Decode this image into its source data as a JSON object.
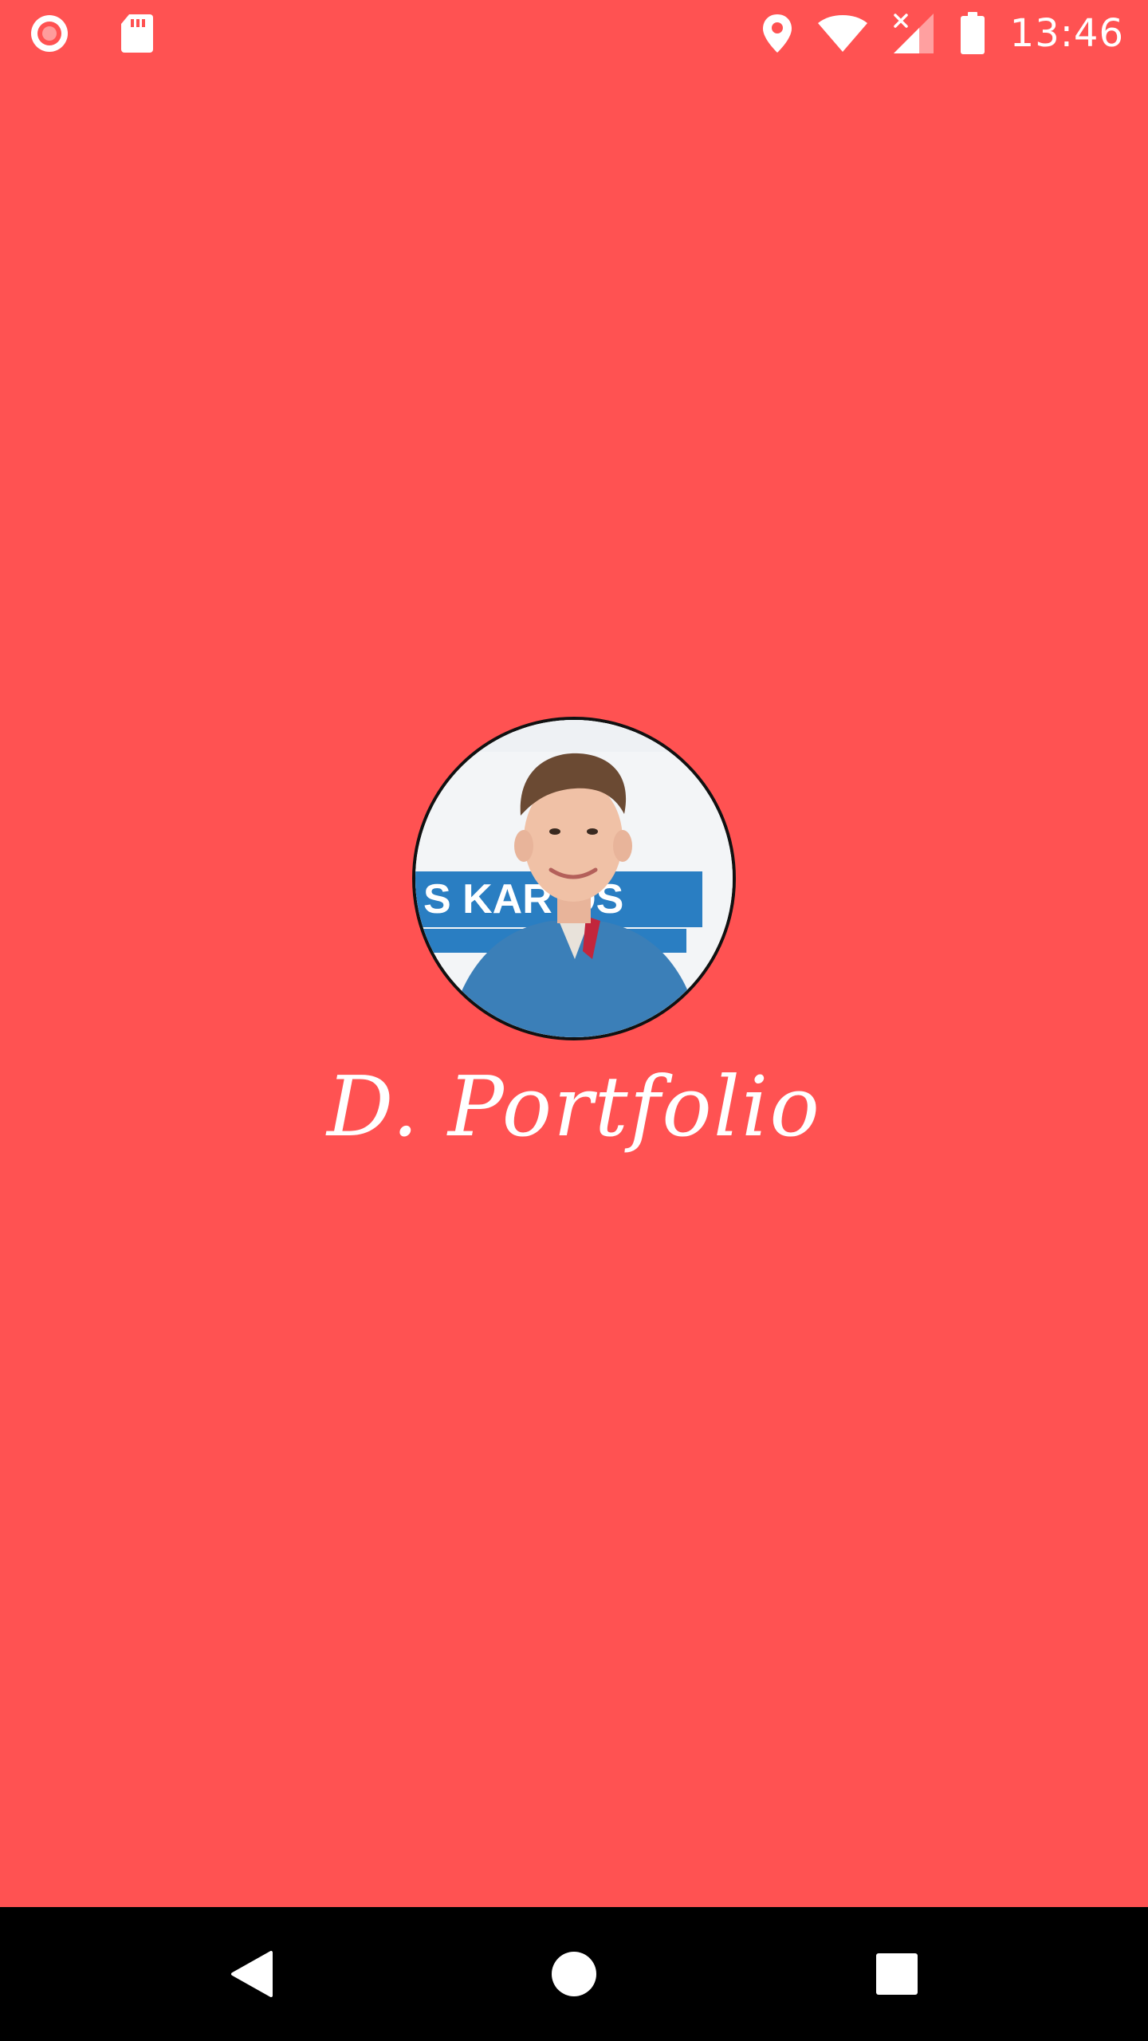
{
  "status_bar": {
    "time": "13:46",
    "left_icons": [
      "screen-record-icon",
      "sd-card-icon"
    ],
    "right_icons": [
      "location-icon",
      "wifi-icon",
      "no-signal-icon",
      "battery-icon"
    ]
  },
  "splash": {
    "title": "D. Portfolio",
    "avatar_alt": "profile-photo",
    "background_color": "#FF5252",
    "title_color": "#FFFFFF"
  },
  "nav_bar": {
    "buttons": [
      "back-icon",
      "home-icon",
      "recents-icon"
    ],
    "background_color": "#000000"
  }
}
